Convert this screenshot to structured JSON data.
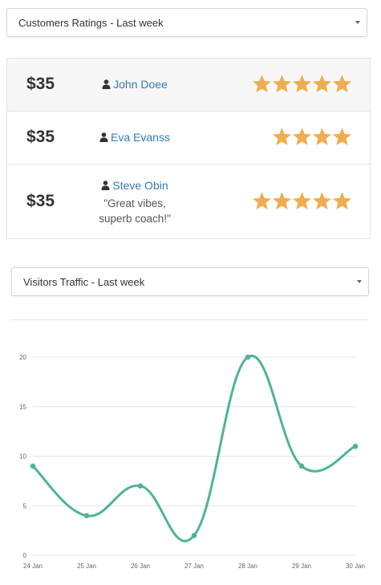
{
  "ratings_select": {
    "value": "Customers Ratings - Last week"
  },
  "ratings": [
    {
      "price": "$35",
      "name": "John Doee",
      "quote": "",
      "stars": 5
    },
    {
      "price": "$35",
      "name": "Eva Evanss",
      "quote": "",
      "stars": 4
    },
    {
      "price": "$35",
      "name": "Steve Obin",
      "quote": "\"Great vibes, superb coach!\"",
      "stars": 5
    }
  ],
  "traffic_select": {
    "value": "Visitors Traffic - Last week"
  },
  "colors": {
    "star": "#f0ad4e",
    "link": "#337ab7",
    "line": "#4fb493"
  },
  "chart_data": {
    "type": "line",
    "categories": [
      "24 Jan",
      "25 Jan",
      "26 Jan",
      "27 Jan",
      "28 Jan",
      "29 Jan",
      "30 Jan"
    ],
    "series": [
      {
        "values": [
          9,
          4,
          7,
          2,
          20,
          9,
          11
        ]
      }
    ],
    "yticks": [
      0,
      5,
      10,
      15,
      20
    ],
    "ylim": [
      0,
      20
    ],
    "grid": true,
    "title": "",
    "xlabel": "",
    "ylabel": ""
  }
}
